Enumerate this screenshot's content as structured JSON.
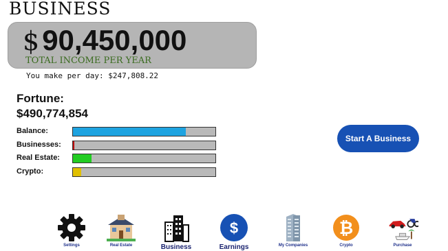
{
  "header": {
    "title": "BUSINESS"
  },
  "income": {
    "currency": "$",
    "amount": "90,450,000",
    "subtitle": "TOTAL INCOME PER YEAR",
    "per_day": "You make per day: $247,808.22"
  },
  "fortune": {
    "label": "Fortune:",
    "value": "$490,774,854"
  },
  "stats": [
    {
      "label": "Balance:",
      "fraction": 0.79,
      "color": "#1ea3e0"
    },
    {
      "label": "Businesses:",
      "fraction": 0.01,
      "color": "#c00000"
    },
    {
      "label": "Real Estate:",
      "fraction": 0.13,
      "color": "#22cc22"
    },
    {
      "label": "Crypto:",
      "fraction": 0.06,
      "color": "#e0c000"
    }
  ],
  "start_button": {
    "label": "Start A Business"
  },
  "nav": {
    "items": [
      {
        "label": "Settings",
        "icon": "gear-icon"
      },
      {
        "label": "Real Estate",
        "icon": "house-icon"
      },
      {
        "label": "Business",
        "icon": "buildings-icon"
      },
      {
        "label": "Earnings",
        "icon": "dollar-coin-icon"
      },
      {
        "label": "My Companies",
        "icon": "skyscraper-icon"
      },
      {
        "label": "Crypto",
        "icon": "bitcoin-icon"
      },
      {
        "label": "Purchase",
        "icon": "vehicles-icon"
      }
    ]
  },
  "colors": {
    "income_box": "#b5b5b5",
    "subtitle_green": "#3a6b1f",
    "button_blue": "#1751b4",
    "nav_label": "#1d2f8a"
  }
}
